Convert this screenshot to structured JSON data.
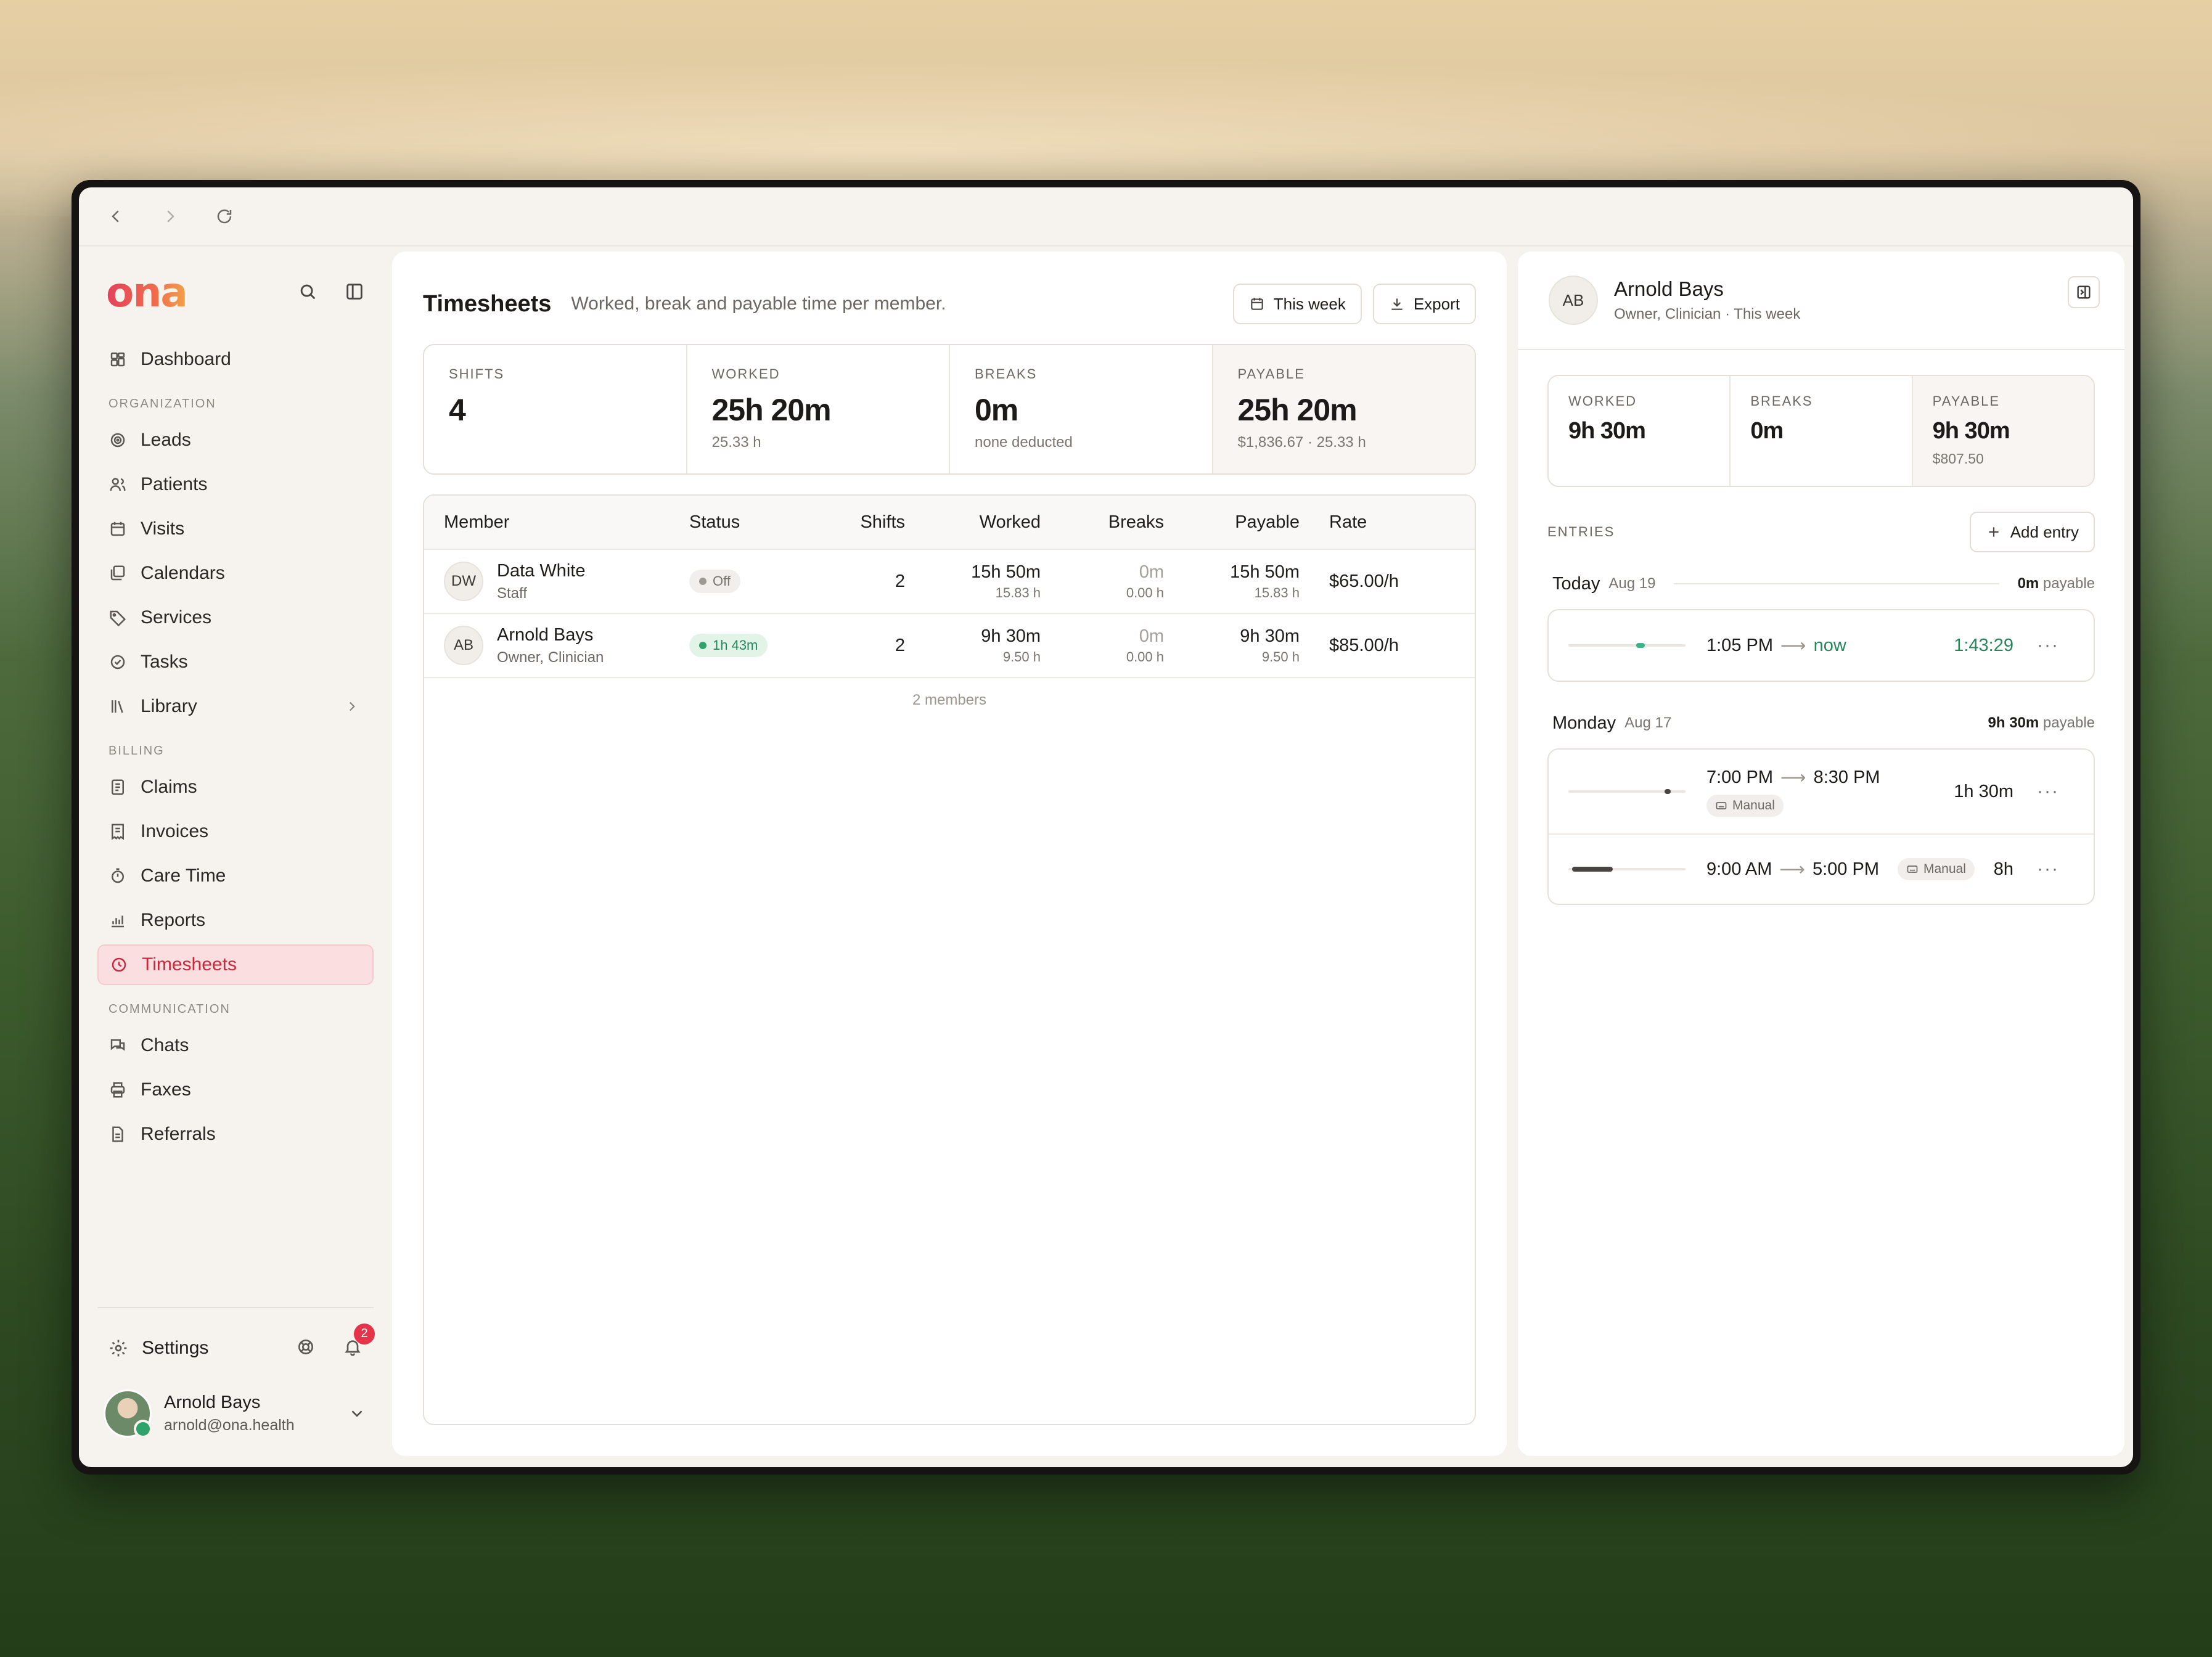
{
  "sidebar": {
    "logo": "ona",
    "items_top": [
      {
        "label": "Dashboard",
        "icon": "dashboard-icon"
      }
    ],
    "sections": [
      {
        "title": "ORGANIZATION",
        "items": [
          {
            "label": "Leads"
          },
          {
            "label": "Patients"
          },
          {
            "label": "Visits"
          },
          {
            "label": "Calendars"
          },
          {
            "label": "Services"
          },
          {
            "label": "Tasks"
          },
          {
            "label": "Library"
          }
        ]
      },
      {
        "title": "BILLING",
        "items": [
          {
            "label": "Claims"
          },
          {
            "label": "Invoices"
          },
          {
            "label": "Care Time"
          },
          {
            "label": "Reports"
          },
          {
            "label": "Timesheets"
          }
        ]
      },
      {
        "title": "COMMUNICATION",
        "items": [
          {
            "label": "Chats"
          },
          {
            "label": "Faxes"
          },
          {
            "label": "Referrals"
          }
        ]
      }
    ],
    "settings_label": "Settings",
    "notification_count": "2",
    "user": {
      "name": "Arnold Bays",
      "email": "arnold@ona.health"
    }
  },
  "main": {
    "title": "Timesheets",
    "subtitle": "Worked, break and payable time per member.",
    "range_button": "This week",
    "export_button": "Export",
    "stats": [
      {
        "label": "SHIFTS",
        "value": "4",
        "sub": ""
      },
      {
        "label": "WORKED",
        "value": "25h 20m",
        "sub": "25.33 h"
      },
      {
        "label": "BREAKS",
        "value": "0m",
        "sub": "none deducted"
      },
      {
        "label": "PAYABLE",
        "value": "25h 20m",
        "sub": "$1,836.67 · 25.33 h"
      }
    ],
    "columns": {
      "member": "Member",
      "status": "Status",
      "shifts": "Shifts",
      "worked": "Worked",
      "breaks": "Breaks",
      "payable": "Payable",
      "rate": "Rate"
    },
    "rows": [
      {
        "initials": "DW",
        "name": "Data White",
        "role": "Staff",
        "status": "Off",
        "shifts": "2",
        "worked": "15h 50m",
        "worked_h": "15.83 h",
        "breaks": "0m",
        "breaks_h": "0.00 h",
        "payable": "15h 50m",
        "payable_h": "15.83 h",
        "rate": "$65.00/h"
      },
      {
        "initials": "AB",
        "name": "Arnold Bays",
        "role": "Owner, Clinician",
        "status": "1h 43m",
        "shifts": "2",
        "worked": "9h 30m",
        "worked_h": "9.50 h",
        "breaks": "0m",
        "breaks_h": "0.00 h",
        "payable": "9h 30m",
        "payable_h": "9.50 h",
        "rate": "$85.00/h"
      }
    ],
    "footer": "2 members"
  },
  "detail": {
    "initials": "AB",
    "name": "Arnold Bays",
    "meta": "Owner, Clinician · This week",
    "stats": [
      {
        "label": "WORKED",
        "value": "9h 30m",
        "sub": ""
      },
      {
        "label": "BREAKS",
        "value": "0m",
        "sub": ""
      },
      {
        "label": "PAYABLE",
        "value": "9h 30m",
        "sub": "$807.50"
      }
    ],
    "entries_label": "ENTRIES",
    "add_entry": "Add entry",
    "days": [
      {
        "name": "Today",
        "date": "Aug 19",
        "payable_value": "0m",
        "payable_word": "payable",
        "entries": [
          {
            "start": "1:05 PM",
            "end": "now",
            "duration": "1:43:29",
            "manual": ""
          }
        ]
      },
      {
        "name": "Monday",
        "date": "Aug 17",
        "payable_value": "9h 30m",
        "payable_word": "payable",
        "entries": [
          {
            "start": "7:00 PM",
            "end": "8:30 PM",
            "duration": "1h 30m",
            "manual": "Manual"
          },
          {
            "start": "9:00 AM",
            "end": "5:00 PM",
            "duration": "8h",
            "manual": "Manual"
          }
        ]
      }
    ]
  },
  "colors": {
    "accent": "#c9283e",
    "active_bg": "#fbdfe0",
    "success": "#25875a",
    "badge": "#e3344a"
  }
}
